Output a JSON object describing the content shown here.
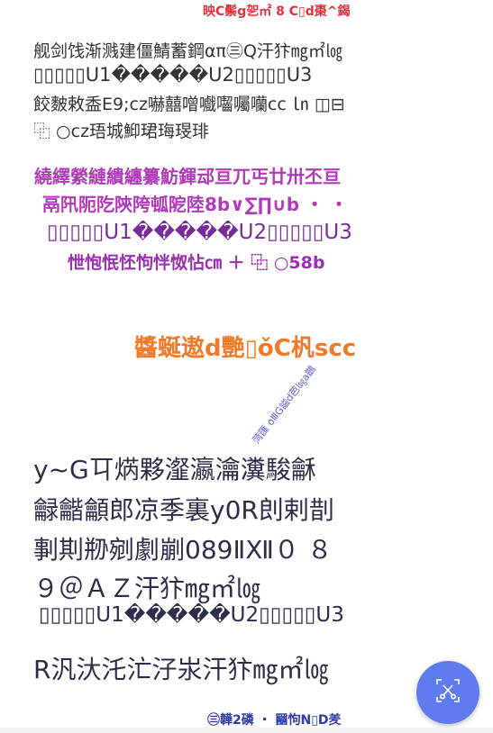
{
  "top_line": "映C鬃g乫㎡ 8 C▯d棗^鍻",
  "gray_block": [
    "舰剑饯渐溅建僵鯖蓄鋼απ㊂Q汗犿㎎㎡㏒",
    "▯▯▯▯▯U1�����U2▯▯▯▯▯U3",
    "餃麬敕盉E9;cz嚇囍噌嚱囓囑囒cc ㏑ ◫⊟",
    "⿻ ○cz珸城鮣珺珻琝琲"
  ],
  "purple_block": [
    "繞繹縈縺繢纏纂魴鍕䢵亘兀丐廿卅丕亘",
    "鬲阠阨阣陝陓㼊阸陸8b∨∑∏∪b ・ ・",
    "▯▯▯▯▯U1�����U2▯▯▯▯▯U3",
    "怈怉怋怌怐怑怓怗㎝ ＋ ⿻ ○58b"
  ],
  "orange_line": "醬蜒遨d艷▯ǒC杋scc",
  "rotated_line": "菏匯 oⅢG謚d芭㏒a鷀",
  "dark_block": [
    "y~G㔿焫夥瀣瀛瀹瀵駿龢",
    "龣龤龥郎凉季裏y0R剆剌剒",
    "剚剘剙剜劇剻089ⅡⅫ０ ８",
    "９＠ＡＺ汗犿㎎㎡㏒",
    "▯▯▯▯▯U1�����U2▯▯▯▯▯U3",
    "R汎汏汑汒汓汖汗犿㎎㎡㏒"
  ],
  "bottom_line": "㊂韡2磷 ・ 圝怐N▯D羑",
  "fab": {
    "icon": "screenshot-scissors-icon",
    "color": "#5f7bf0"
  }
}
